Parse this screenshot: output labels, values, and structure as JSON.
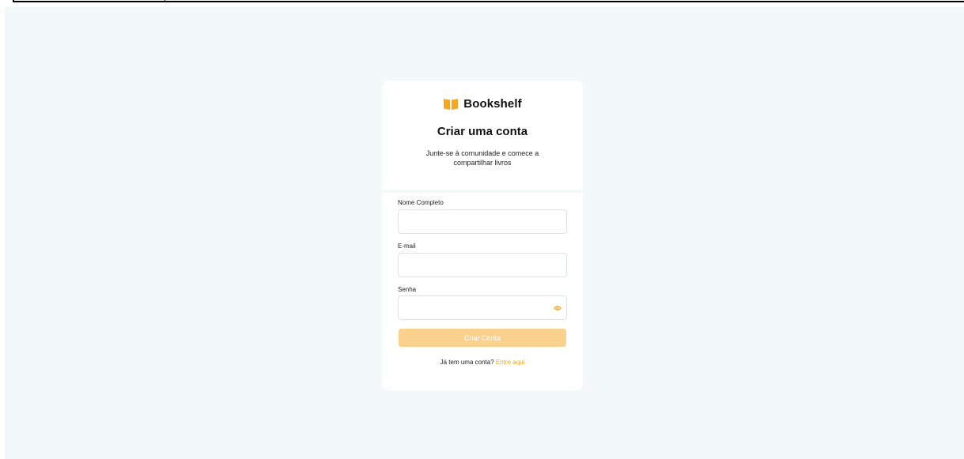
{
  "app": {
    "name": "Bookshelf",
    "accent": "#f5a623",
    "icon": "open-book-icon"
  },
  "header": {
    "title": "Criar uma conta",
    "subtitle": "Junte-se à comunidade e comece a compartilhar livros"
  },
  "form": {
    "fields": [
      {
        "label": "Nome Completo",
        "value": "",
        "placeholder": ""
      },
      {
        "label": "E-mail",
        "value": "",
        "placeholder": ""
      },
      {
        "label": "Senha",
        "value": "",
        "placeholder": "",
        "icon": "eye-icon"
      }
    ],
    "submit_label": "Criar Conta",
    "submit_color": "#fbd18e"
  },
  "footer": {
    "text": "Já tem uma conta?",
    "link_label": "Entre aqui"
  }
}
